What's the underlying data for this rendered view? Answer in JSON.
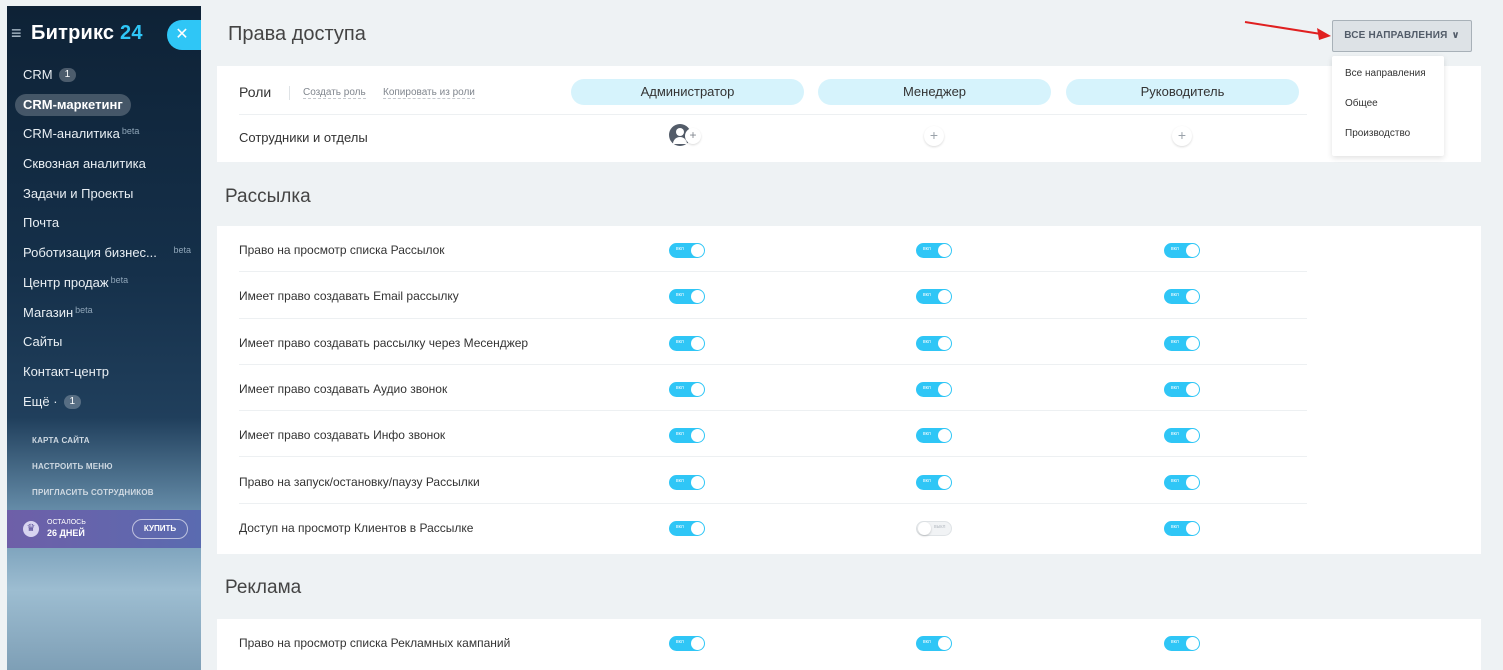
{
  "sidebar": {
    "logo_name": "Битрикс",
    "logo_number": "24",
    "items": [
      {
        "label": "CRM",
        "counter": "1",
        "beta": ""
      },
      {
        "label": "CRM-маркетинг",
        "counter": "",
        "beta": "",
        "active": true
      },
      {
        "label": "CRM-аналитика",
        "counter": "",
        "beta": "beta"
      },
      {
        "label": "Сквозная аналитика",
        "counter": "",
        "beta": ""
      },
      {
        "label": "Задачи и Проекты",
        "counter": "",
        "beta": ""
      },
      {
        "label": "Почта",
        "counter": "",
        "beta": ""
      },
      {
        "label": "Роботизация бизнес...",
        "counter": "",
        "beta": "beta"
      },
      {
        "label": "Центр продаж",
        "counter": "",
        "beta": "beta"
      },
      {
        "label": "Магазин",
        "counter": "",
        "beta": "beta"
      },
      {
        "label": "Сайты",
        "counter": "",
        "beta": ""
      },
      {
        "label": "Контакт-центр",
        "counter": "",
        "beta": ""
      },
      {
        "label": "Ещё ·",
        "counter": "1",
        "beta": ""
      }
    ],
    "sitemap": "КАРТА САЙТА",
    "configure_menu": "НАСТРОИТЬ МЕНЮ",
    "invite": "ПРИГЛАСИТЬ СОТРУДНИКОВ",
    "trial_left": "ОСТАЛОСЬ",
    "trial_days": "26 ДНЕЙ",
    "buy": "КУПИТЬ"
  },
  "header": {
    "title": "Права доступа",
    "directions_button": "ВСЕ НАПРАВЛЕНИЯ",
    "directions_options": [
      "Все направления",
      "Общее",
      "Производство"
    ]
  },
  "roles": {
    "label": "Роли",
    "create_role": "Создать роль",
    "copy_role": "Копировать из роли",
    "columns": [
      "Администратор",
      "Менеджер",
      "Руководитель"
    ],
    "employees_label": "Сотрудники и отделы"
  },
  "sections": [
    {
      "title": "Рассылка",
      "rules": [
        {
          "label": "Право на просмотр списка Рассылок",
          "values": [
            true,
            true,
            true
          ]
        },
        {
          "label": "Имеет право создавать Email рассылку",
          "values": [
            true,
            true,
            true
          ]
        },
        {
          "label": "Имеет право создавать рассылку через Месенджер",
          "values": [
            true,
            true,
            true
          ]
        },
        {
          "label": "Имеет право создавать Аудио звонок",
          "values": [
            true,
            true,
            true
          ]
        },
        {
          "label": "Имеет право создавать Инфо звонок",
          "values": [
            true,
            true,
            true
          ]
        },
        {
          "label": "Право на запуск/остановку/паузу Рассылки",
          "values": [
            true,
            true,
            true
          ]
        },
        {
          "label": "Доступ на просмотр Клиентов в Рассылке",
          "values": [
            true,
            false,
            true
          ]
        }
      ]
    },
    {
      "title": "Реклама",
      "rules": [
        {
          "label": "Право на просмотр списка Рекламных кампаний",
          "values": [
            true,
            true,
            true
          ]
        }
      ]
    }
  ],
  "toggle_on_text": "вкл",
  "toggle_off_text": "выкл",
  "colors": {
    "accent": "#2fc6f6",
    "pill": "#d6f3fc",
    "arrow": "#e02020"
  }
}
